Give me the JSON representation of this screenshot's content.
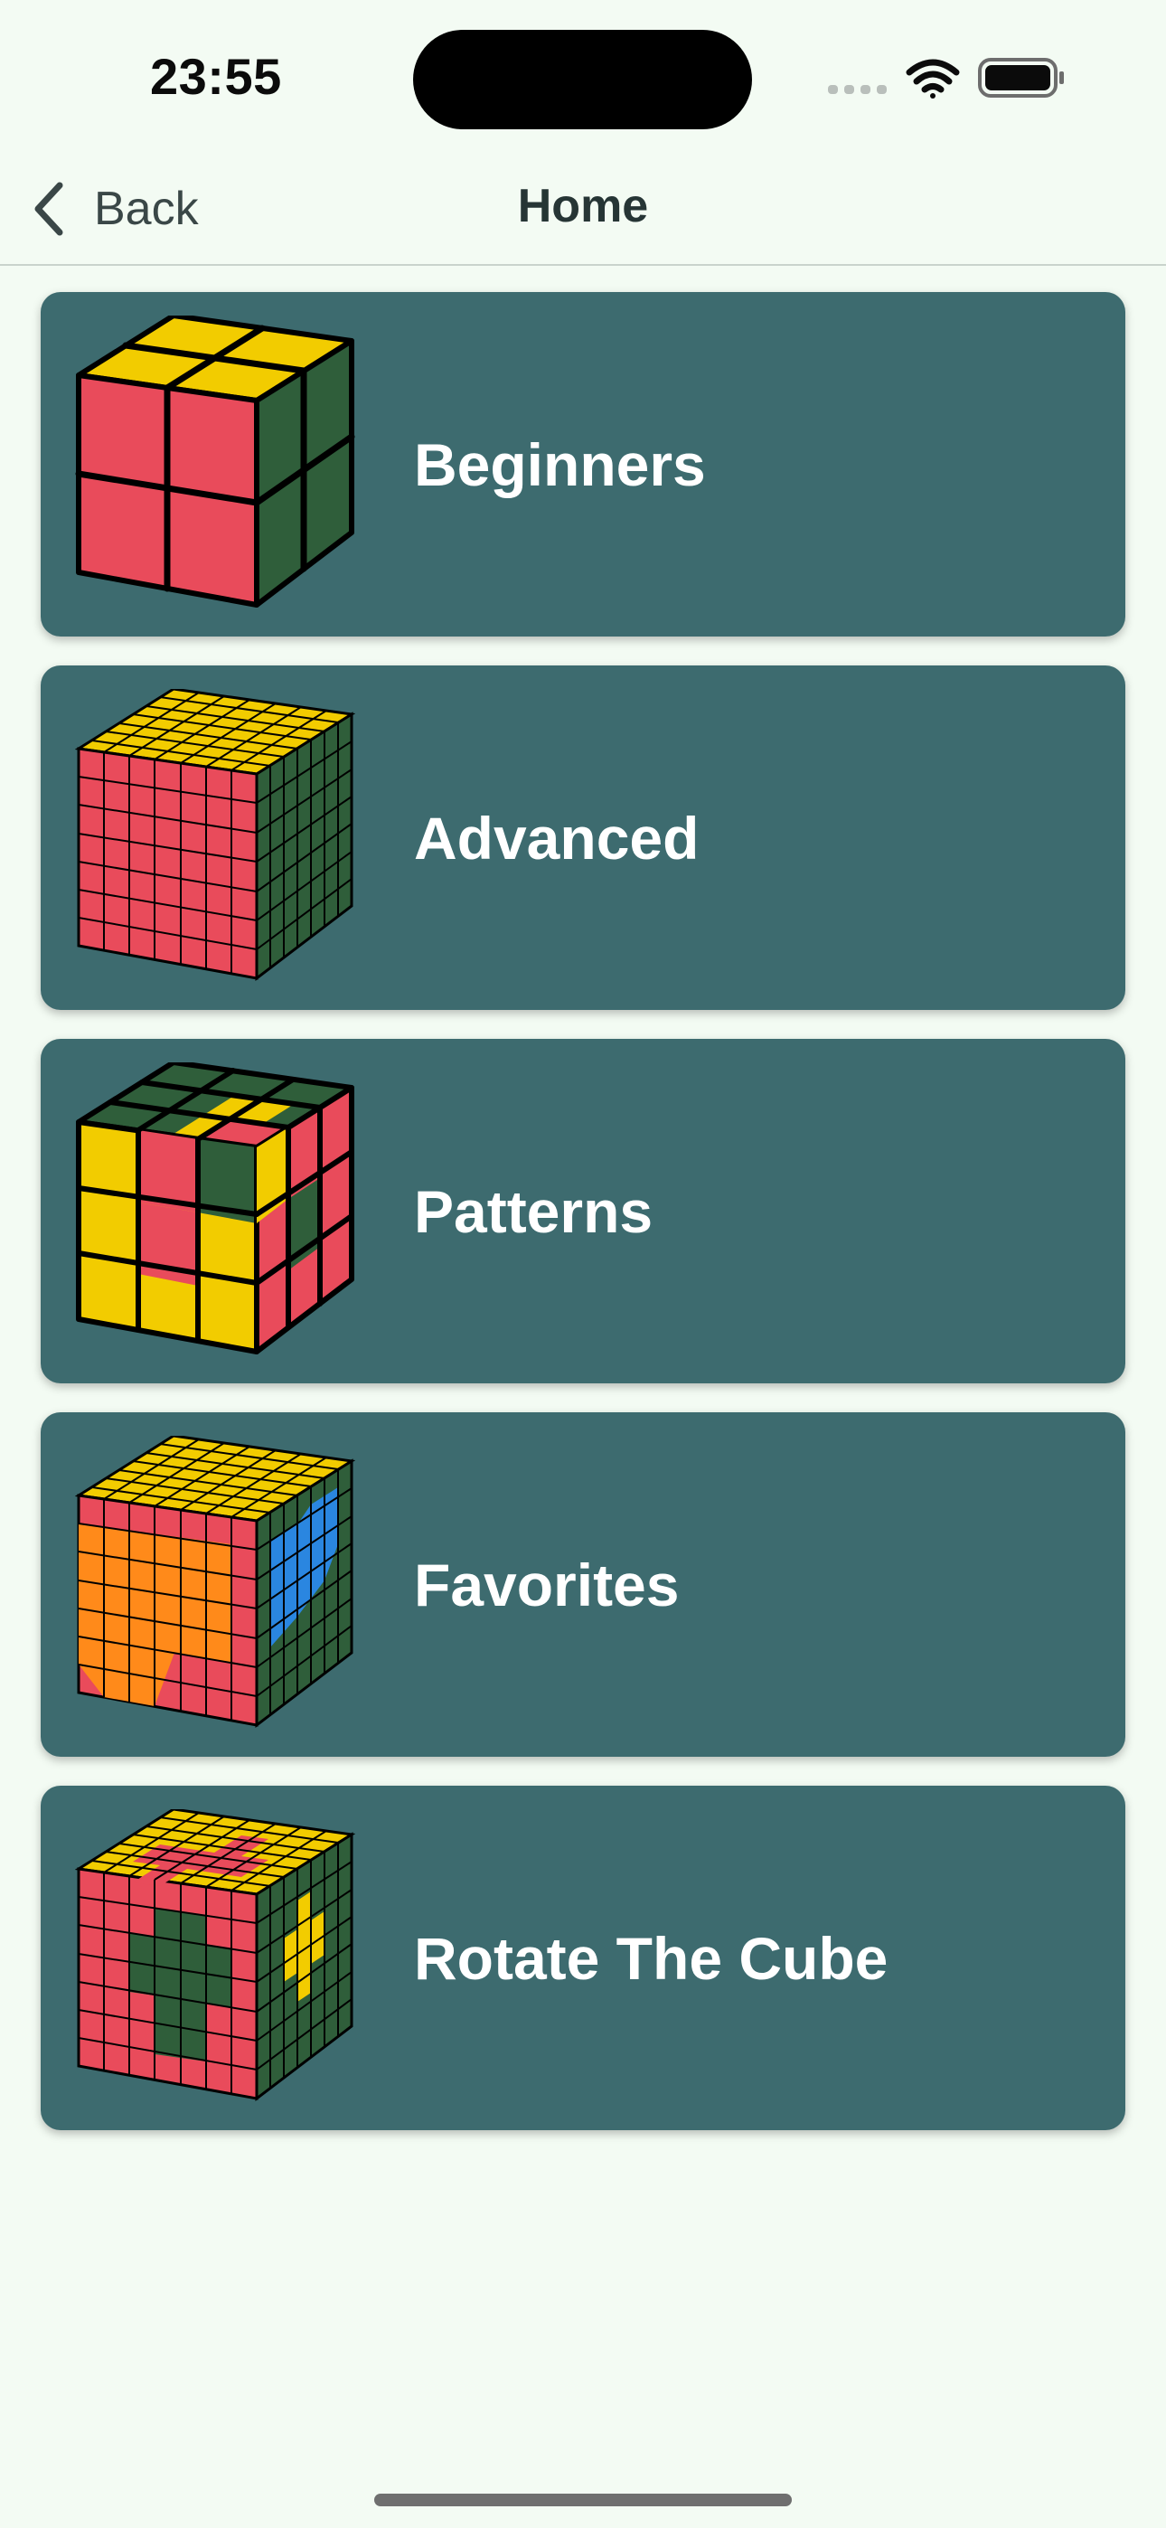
{
  "status_bar": {
    "time": "23:55",
    "icons": [
      "signal-dots-icon",
      "wifi-icon",
      "battery-icon"
    ]
  },
  "nav": {
    "back_label": "Back",
    "title": "Home"
  },
  "menu": {
    "items": [
      {
        "label": "Beginners",
        "icon": "cube-2x2-icon"
      },
      {
        "label": "Advanced",
        "icon": "cube-7x7-icon"
      },
      {
        "label": "Patterns",
        "icon": "cube-3x3-pattern-icon"
      },
      {
        "label": "Favorites",
        "icon": "cube-heart-icon"
      },
      {
        "label": "Rotate The Cube",
        "icon": "cube-cross-icon"
      }
    ]
  },
  "colors": {
    "background": "#f3fbf3",
    "card": "#3d6b6f",
    "card_text": "#ffffff",
    "cube_red": "#e94b5b",
    "cube_yellow": "#f2cc00",
    "cube_green": "#2f5e3a",
    "cube_orange": "#ff8a1a",
    "cube_blue": "#2a86e0"
  }
}
